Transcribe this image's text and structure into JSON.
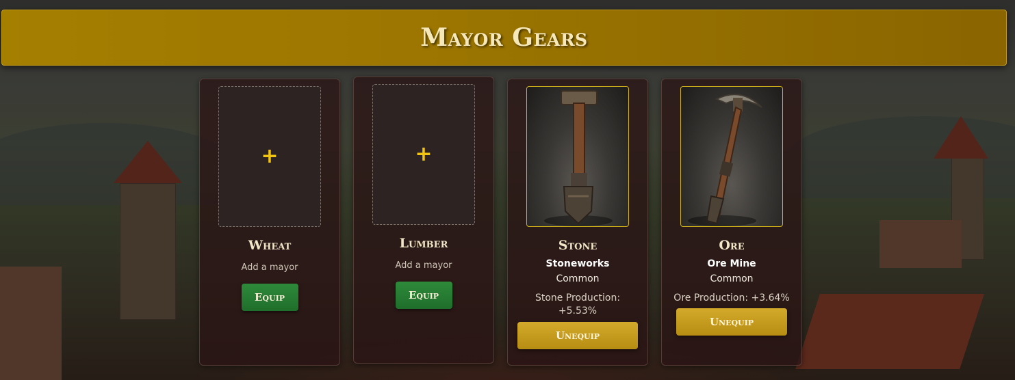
{
  "header": {
    "title": "Mayor Gears"
  },
  "cards": [
    {
      "resource": "Wheat",
      "slot_icon": "+",
      "hint": "Add a mayor",
      "equip_label": "Equip"
    },
    {
      "resource": "Lumber",
      "slot_icon": "+",
      "hint": "Add a mayor",
      "equip_label": "Equip"
    },
    {
      "resource": "Stone",
      "gear_name": "Stoneworks",
      "rarity": "Common",
      "bonus_label": "Stone Production:",
      "bonus_value": "+5.53%",
      "unequip_label": "Unequip",
      "image_icon": "shovel-icon"
    },
    {
      "resource": "Ore",
      "gear_name": "Ore Mine",
      "rarity": "Common",
      "bonus_text": "Ore Production: +3.64%",
      "unequip_label": "Unequip",
      "image_icon": "pickaxe-icon"
    }
  ],
  "colors": {
    "header_gold": "#a57f00",
    "equip_green": "#2e8a3a",
    "unequip_gold": "#d4aa2c",
    "plus_yellow": "#f2c412"
  }
}
